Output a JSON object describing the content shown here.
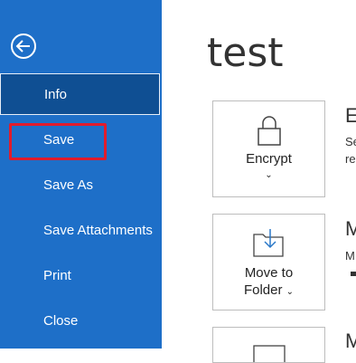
{
  "sidebar": {
    "items": [
      {
        "label": "Info"
      },
      {
        "label": "Save"
      },
      {
        "label": "Save As"
      },
      {
        "label": "Save Attachments"
      },
      {
        "label": "Print"
      },
      {
        "label": "Close"
      }
    ]
  },
  "main": {
    "title": "test",
    "cards": [
      {
        "label": "Encrypt",
        "icon": "lock-icon"
      },
      {
        "label_line1": "Move to",
        "label_line2": "Folder",
        "icon": "move-to-folder-icon"
      },
      {
        "icon": "envelope-icon"
      }
    ],
    "side_text": {
      "encrypt_head": "E",
      "encrypt_sub1": "Se",
      "encrypt_sub2": "re",
      "move_head": "M",
      "move_sub1": "M",
      "third_head": "M"
    }
  },
  "colors": {
    "sidebar": "#1e6fc8",
    "selected": "#0f4f93",
    "highlight": "#e11c2c"
  }
}
